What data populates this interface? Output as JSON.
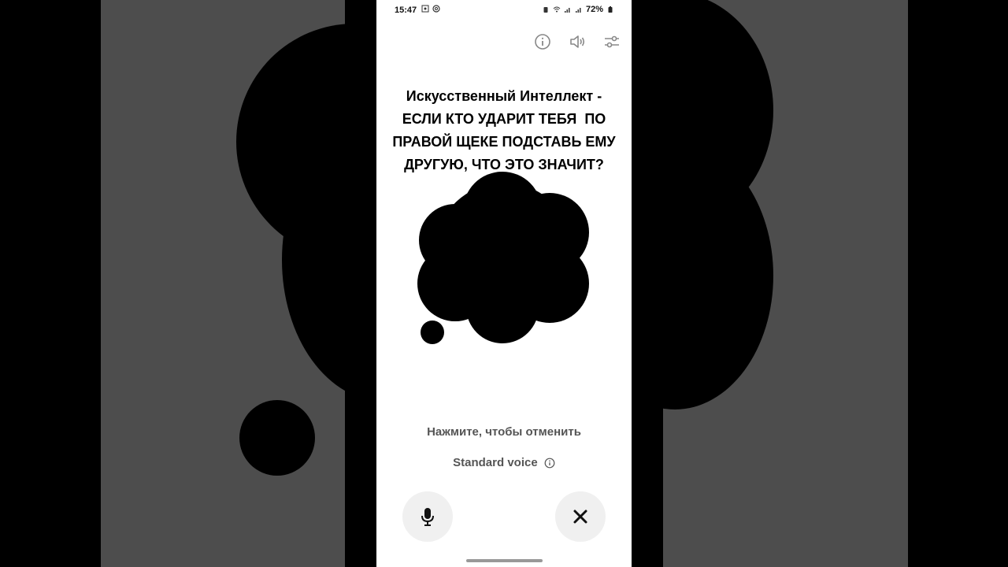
{
  "status_bar": {
    "time": "15:47",
    "battery": "72%"
  },
  "toolbar": {
    "info_icon": "info-icon",
    "speaker_icon": "speaker-icon",
    "settings_icon": "sliders-icon"
  },
  "prompt": {
    "line1": "Искусственный Интеллект -",
    "line2": "ЕСЛИ КТО УДАРИТ ТЕБЯ  ПО",
    "line3": "ПРАВОЙ ЩЕКЕ ПОДСТАВЬ ЕМУ",
    "line4": "ДРУГУЮ, ЧТО ЭТО ЗНАЧИТ?"
  },
  "hint": "Нажмите, чтобы отменить",
  "voice": {
    "label": "Standard voice"
  },
  "controls": {
    "mic_icon": "microphone-icon",
    "close_icon": "close-icon"
  },
  "colors": {
    "blurred_background": "#4d4d4d",
    "phone_background": "#ffffff",
    "button_background": "#f0f0f0",
    "orb": "#000000"
  }
}
